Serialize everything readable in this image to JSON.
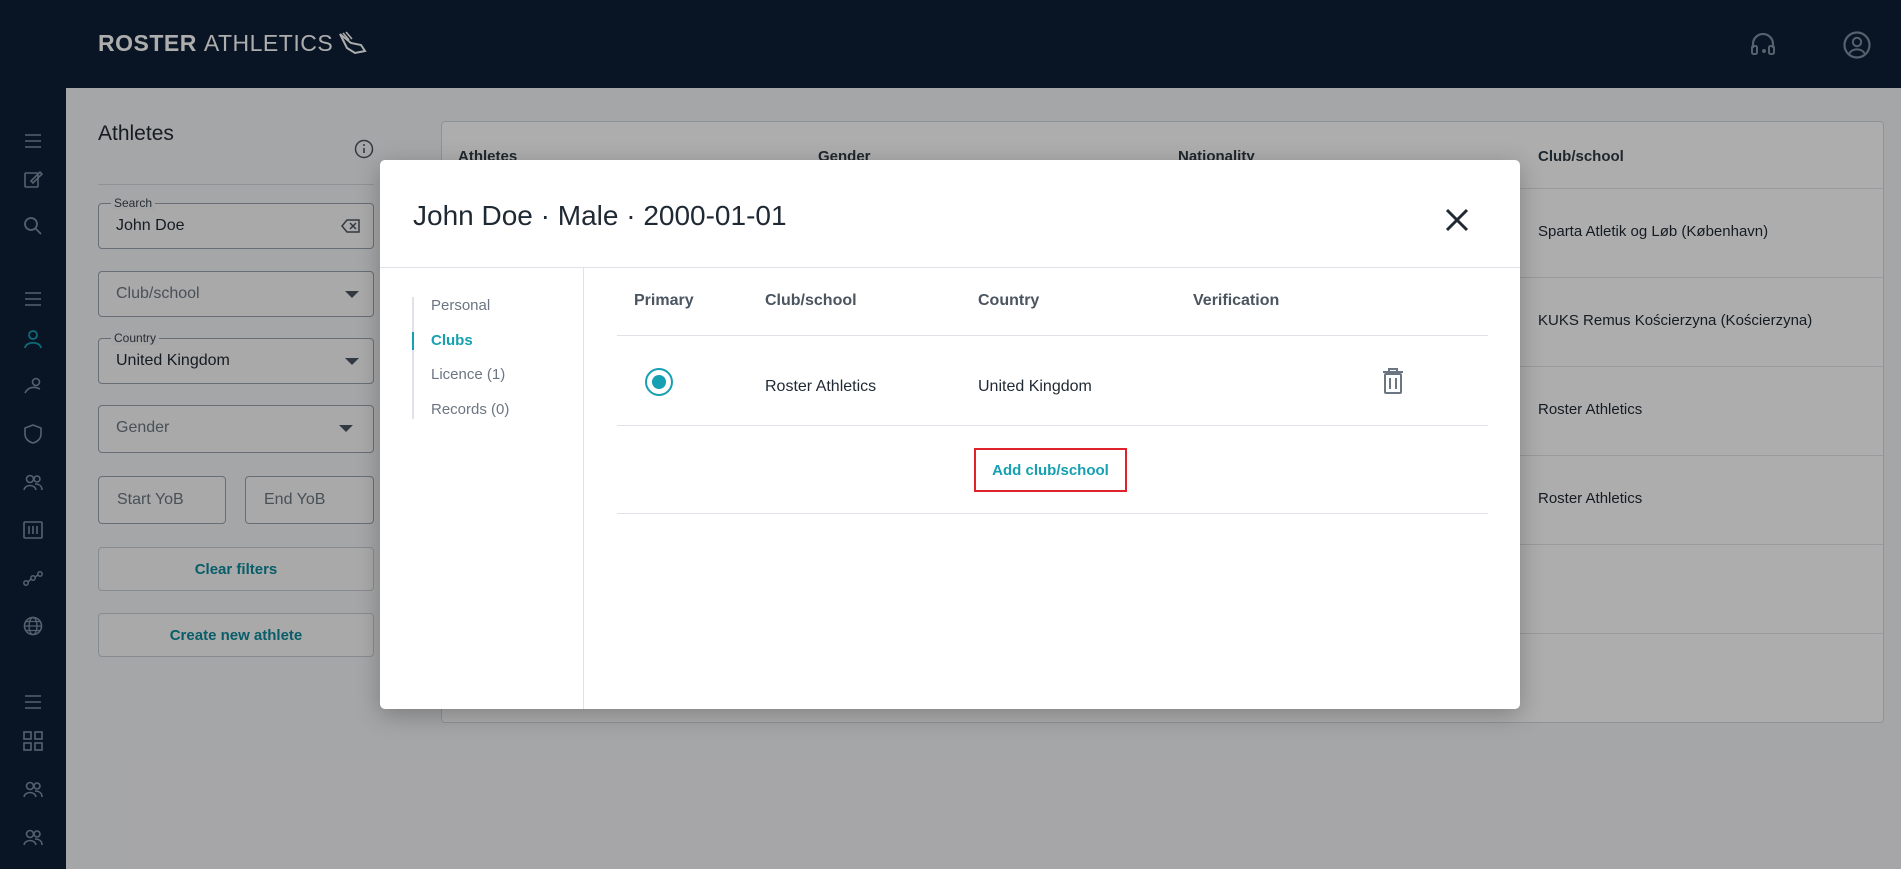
{
  "header": {
    "brand_bold": "ROSTER",
    "brand_light": "ATHLETICS",
    "icons": [
      "headset-icon",
      "account-circle-icon"
    ]
  },
  "rail": {
    "icons": [
      "menu-icon",
      "edit-icon",
      "search-icon",
      "menu-icon",
      "person-icon",
      "running-icon",
      "shield-icon",
      "group-icon",
      "scoreboard-icon",
      "route-icon",
      "globe-icon",
      "menu-icon",
      "grid-icon",
      "group-icon",
      "group-icon"
    ]
  },
  "filters": {
    "title": "Athletes",
    "search_label": "Search",
    "search_value": "John Doe",
    "club_placeholder": "Club/school",
    "country_label": "Country",
    "country_value": "United Kingdom",
    "gender_placeholder": "Gender",
    "start_yob": "Start YoB",
    "end_yob": "End YoB",
    "clear_filters": "Clear filters",
    "create_athlete": "Create new athlete"
  },
  "background_table": {
    "headers": [
      "Athletes",
      "Gender",
      "Nationality",
      "Club/school"
    ],
    "club_cells": [
      "Sparta Atletik og Løb (København)",
      "KUKS Remus Kościerzyna (Kościerzyna)",
      "Roster Athletics",
      "Roster Athletics"
    ]
  },
  "modal": {
    "title": "John Doe · Male · 2000-01-01",
    "nav": [
      {
        "label": "Personal",
        "active": false
      },
      {
        "label": "Clubs",
        "active": true
      },
      {
        "label": "Licence (1)",
        "active": false
      },
      {
        "label": "Records (0)",
        "active": false
      }
    ],
    "columns": [
      "Primary",
      "Club/school",
      "Country",
      "Verification"
    ],
    "rows": [
      {
        "primary": true,
        "club": "Roster Athletics",
        "country": "United Kingdom",
        "verification": ""
      }
    ],
    "add_button": "Add club/school"
  },
  "colors": {
    "navy": "#0e1f35",
    "accent": "#16a0b2",
    "highlight": "#e0232a"
  }
}
